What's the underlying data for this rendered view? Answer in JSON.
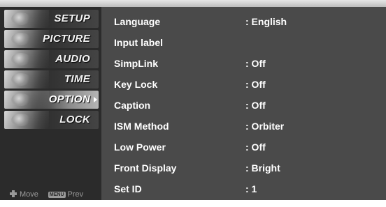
{
  "sidebar": {
    "items": [
      {
        "label": "SETUP",
        "selected": false
      },
      {
        "label": "PICTURE",
        "selected": false
      },
      {
        "label": "AUDIO",
        "selected": false
      },
      {
        "label": "TIME",
        "selected": false
      },
      {
        "label": "OPTION",
        "selected": true
      },
      {
        "label": "LOCK",
        "selected": false
      }
    ],
    "hint_move": "Move",
    "hint_menu_key": "MENU",
    "hint_prev": "Prev"
  },
  "settings": [
    {
      "label": "Language",
      "value": ": English"
    },
    {
      "label": "Input label",
      "value": ""
    },
    {
      "label": "SimpLink",
      "value": ": Off"
    },
    {
      "label": "Key Lock",
      "value": ": Off"
    },
    {
      "label": "Caption",
      "value": ": Off"
    },
    {
      "label": "ISM Method",
      "value": ": Orbiter"
    },
    {
      "label": "Low Power",
      "value": ": Off"
    },
    {
      "label": "Front Display",
      "value": ": Bright"
    },
    {
      "label": "Set ID",
      "value": ": 1"
    }
  ],
  "colors": {
    "content_bg": "#4a4a4a",
    "sidebar_bg": "#2b2b2b",
    "text": "#ffffff"
  },
  "icons": [
    "move-icon",
    "menu-key-icon",
    "selection-arrow-icon"
  ]
}
